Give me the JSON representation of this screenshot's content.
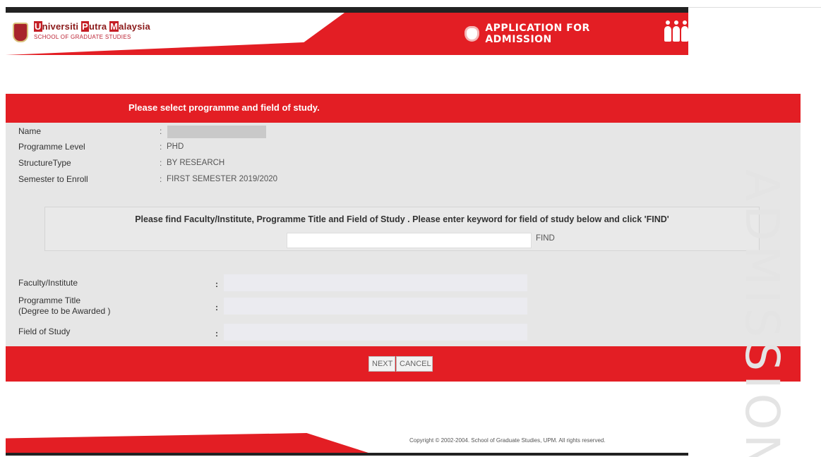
{
  "header": {
    "logo_name_parts": [
      {
        "cap": "U",
        "rest": "niversiti "
      },
      {
        "cap": "P",
        "rest": "utra "
      },
      {
        "cap": "M",
        "rest": "alaysia"
      }
    ],
    "logo_subtitle": "SCHOOL OF GRADUATE STUDIES",
    "app_title": "APPLICATION FOR ADMISSION"
  },
  "panel": {
    "title": "Please select programme and field of study.",
    "info": {
      "name_label": "Name",
      "programme_level_label": "Programme Level",
      "programme_level_value": "PHD",
      "structure_label": "StructureType",
      "structure_value": "BY RESEARCH",
      "semester_label": "Semester to Enroll",
      "semester_value": "FIRST SEMESTER 2019/2020",
      "separator": ":"
    },
    "find": {
      "instruction": "Please find Faculty/Institute, Programme Title and Field of Study . Please enter keyword for field of study below and click 'FIND'",
      "input_value": "",
      "button_label": "FIND"
    },
    "fields": {
      "faculty_label": "Faculty/Institute",
      "programme_title_label_line1": "Programme Title",
      "programme_title_label_line2": "(Degree to be Awarded )",
      "field_of_study_label": "Field of Study",
      "separator": ":"
    },
    "actions": {
      "next_label": "NEXT",
      "cancel_label": "CANCEL"
    }
  },
  "watermark": "ADMISSION",
  "footer": {
    "copyright": "Copyright © 2002-2004. School of Graduate Studies, UPM. All rights reserved."
  },
  "colors": {
    "brand_red": "#e31e24",
    "panel_grey": "#e6e6e6"
  }
}
